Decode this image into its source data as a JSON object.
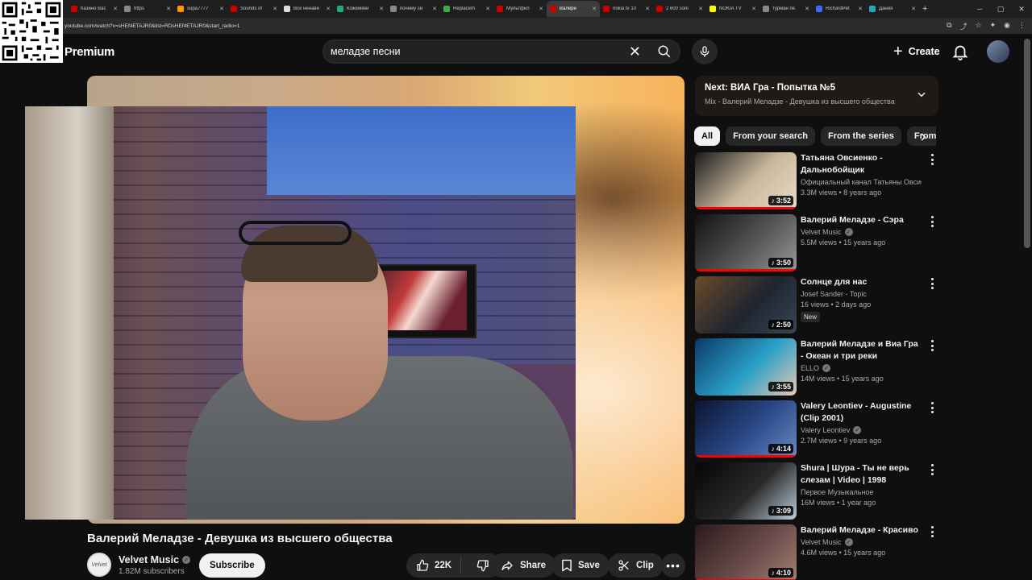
{
  "browser": {
    "tabs": [
      {
        "label": "Казино Вас",
        "color": "#c00"
      },
      {
        "label": "https",
        "color": "#888"
      },
      {
        "label": "supa7777",
        "color": "#f90"
      },
      {
        "label": "Sounds of",
        "color": "#c00"
      },
      {
        "label": "Все ненави",
        "color": "#ddd"
      },
      {
        "label": "Кожемяки",
        "color": "#2a7"
      },
      {
        "label": "почему си",
        "color": "#888"
      },
      {
        "label": "Replacem",
        "color": "#4a4"
      },
      {
        "label": "Мультфил",
        "color": "#c00"
      },
      {
        "label": "Валери",
        "color": "#c00"
      },
      {
        "label": "nokia tv 10",
        "color": "#c00"
      },
      {
        "label": "2 600 soni",
        "color": "#c00"
      },
      {
        "label": "NOKIA TV",
        "color": "#ff0"
      },
      {
        "label": "турман пе",
        "color": "#888"
      },
      {
        "label": "RichardPet",
        "color": "#46f"
      },
      {
        "label": "Дания",
        "color": "#2ab"
      }
    ],
    "url": "youtube.com/watch?v=sHEf4ETAJR0&list=RDsHEf4ETAJR0&start_radio=1",
    "win_min": "─",
    "win_max": "▢",
    "win_close": "✕"
  },
  "header": {
    "logo": "Premium",
    "search_value": "меладзе песни",
    "create_label": "Create"
  },
  "video": {
    "title": "Валерий Меладзе - Девушка из высшего общества",
    "channel": "Velvet Music",
    "channel_avatar_text": "Velvet",
    "subscribers": "1.82M subscribers",
    "subscribe_label": "Subscribe",
    "likes": "22K",
    "share_label": "Share",
    "save_label": "Save",
    "clip_label": "Clip"
  },
  "next": {
    "title": "Next: ВИА Гра - Попытка №5",
    "subtitle": "Mix - Валерий Меладзе - Девушка из высшего общества"
  },
  "chips": [
    "All",
    "From your search",
    "From the series",
    "From"
  ],
  "recommendations": [
    {
      "title": "Татьяна Овсиенко - Дальнобойщик",
      "channel": "Официальный канал Татьяны Овсиенко",
      "meta": "3.3M views • 8 years ago",
      "duration": "3:52",
      "verified": false,
      "badge": "",
      "thumb": [
        "#1a1a1a",
        "#c8b89a",
        "#e9dccb"
      ],
      "watched": true
    },
    {
      "title": "Валерий Меладзе - Сэра",
      "channel": "Velvet Music",
      "meta": "5.5M views • 15 years ago",
      "duration": "3:50",
      "verified": true,
      "badge": "",
      "thumb": [
        "#111",
        "#555",
        "#999"
      ],
      "watched": true
    },
    {
      "title": "Солнце для нас",
      "channel": "Josef Sander - Topic",
      "meta": "16 views • 2 days ago",
      "duration": "2:50",
      "verified": false,
      "badge": "New",
      "thumb": [
        "#6b4a2a",
        "#1e2530",
        "#3a4656"
      ],
      "watched": false
    },
    {
      "title": "Валерий Меладзе и Виа Гра - Океан и три реки",
      "channel": "ELLO",
      "meta": "14M views • 15 years ago",
      "duration": "3:55",
      "verified": true,
      "badge": "",
      "thumb": [
        "#0a3a6a",
        "#2aa0c8",
        "#e8c8b0"
      ],
      "watched": false
    },
    {
      "title": "Valery Leontiev - Augustine (Clip 2001)",
      "channel": "Valery Leontiev",
      "meta": "2.7M views • 9 years ago",
      "duration": "4:14",
      "verified": true,
      "badge": "",
      "thumb": [
        "#0a1430",
        "#2a4a8a",
        "#6a8ac0"
      ],
      "watched": true
    },
    {
      "title": "Shura | Шура - Ты не верь слезам | Video | 1998",
      "channel": "Первое Музыкальное",
      "meta": "16M views • 1 year ago",
      "duration": "3:09",
      "verified": false,
      "badge": "",
      "thumb": [
        "#050505",
        "#2a2a2a",
        "#bcd"
      ],
      "watched": false
    },
    {
      "title": "Валерий Меладзе - Красиво",
      "channel": "Velvet Music",
      "meta": "4.6M views • 15 years ago",
      "duration": "4:10",
      "verified": true,
      "badge": "",
      "thumb": [
        "#2a1a1a",
        "#6a4a4a",
        "#a08070"
      ],
      "watched": true
    }
  ]
}
